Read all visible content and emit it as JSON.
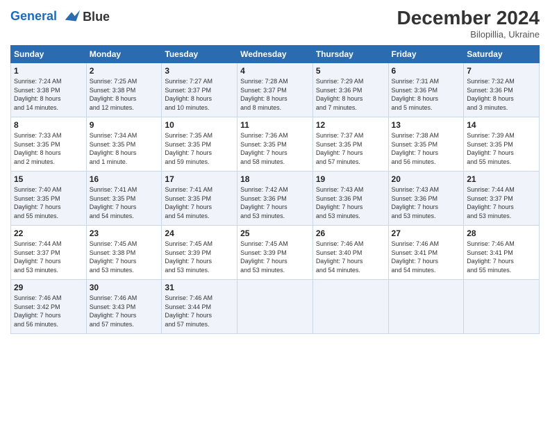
{
  "header": {
    "logo_line1": "General",
    "logo_line2": "Blue",
    "month": "December 2024",
    "location": "Bilopillia, Ukraine"
  },
  "weekdays": [
    "Sunday",
    "Monday",
    "Tuesday",
    "Wednesday",
    "Thursday",
    "Friday",
    "Saturday"
  ],
  "weeks": [
    [
      {
        "day": "1",
        "info": "Sunrise: 7:24 AM\nSunset: 3:38 PM\nDaylight: 8 hours\nand 14 minutes."
      },
      {
        "day": "2",
        "info": "Sunrise: 7:25 AM\nSunset: 3:38 PM\nDaylight: 8 hours\nand 12 minutes."
      },
      {
        "day": "3",
        "info": "Sunrise: 7:27 AM\nSunset: 3:37 PM\nDaylight: 8 hours\nand 10 minutes."
      },
      {
        "day": "4",
        "info": "Sunrise: 7:28 AM\nSunset: 3:37 PM\nDaylight: 8 hours\nand 8 minutes."
      },
      {
        "day": "5",
        "info": "Sunrise: 7:29 AM\nSunset: 3:36 PM\nDaylight: 8 hours\nand 7 minutes."
      },
      {
        "day": "6",
        "info": "Sunrise: 7:31 AM\nSunset: 3:36 PM\nDaylight: 8 hours\nand 5 minutes."
      },
      {
        "day": "7",
        "info": "Sunrise: 7:32 AM\nSunset: 3:36 PM\nDaylight: 8 hours\nand 3 minutes."
      }
    ],
    [
      {
        "day": "8",
        "info": "Sunrise: 7:33 AM\nSunset: 3:35 PM\nDaylight: 8 hours\nand 2 minutes."
      },
      {
        "day": "9",
        "info": "Sunrise: 7:34 AM\nSunset: 3:35 PM\nDaylight: 8 hours\nand 1 minute."
      },
      {
        "day": "10",
        "info": "Sunrise: 7:35 AM\nSunset: 3:35 PM\nDaylight: 7 hours\nand 59 minutes."
      },
      {
        "day": "11",
        "info": "Sunrise: 7:36 AM\nSunset: 3:35 PM\nDaylight: 7 hours\nand 58 minutes."
      },
      {
        "day": "12",
        "info": "Sunrise: 7:37 AM\nSunset: 3:35 PM\nDaylight: 7 hours\nand 57 minutes."
      },
      {
        "day": "13",
        "info": "Sunrise: 7:38 AM\nSunset: 3:35 PM\nDaylight: 7 hours\nand 56 minutes."
      },
      {
        "day": "14",
        "info": "Sunrise: 7:39 AM\nSunset: 3:35 PM\nDaylight: 7 hours\nand 55 minutes."
      }
    ],
    [
      {
        "day": "15",
        "info": "Sunrise: 7:40 AM\nSunset: 3:35 PM\nDaylight: 7 hours\nand 55 minutes."
      },
      {
        "day": "16",
        "info": "Sunrise: 7:41 AM\nSunset: 3:35 PM\nDaylight: 7 hours\nand 54 minutes."
      },
      {
        "day": "17",
        "info": "Sunrise: 7:41 AM\nSunset: 3:35 PM\nDaylight: 7 hours\nand 54 minutes."
      },
      {
        "day": "18",
        "info": "Sunrise: 7:42 AM\nSunset: 3:36 PM\nDaylight: 7 hours\nand 53 minutes."
      },
      {
        "day": "19",
        "info": "Sunrise: 7:43 AM\nSunset: 3:36 PM\nDaylight: 7 hours\nand 53 minutes."
      },
      {
        "day": "20",
        "info": "Sunrise: 7:43 AM\nSunset: 3:36 PM\nDaylight: 7 hours\nand 53 minutes."
      },
      {
        "day": "21",
        "info": "Sunrise: 7:44 AM\nSunset: 3:37 PM\nDaylight: 7 hours\nand 53 minutes."
      }
    ],
    [
      {
        "day": "22",
        "info": "Sunrise: 7:44 AM\nSunset: 3:37 PM\nDaylight: 7 hours\nand 53 minutes."
      },
      {
        "day": "23",
        "info": "Sunrise: 7:45 AM\nSunset: 3:38 PM\nDaylight: 7 hours\nand 53 minutes."
      },
      {
        "day": "24",
        "info": "Sunrise: 7:45 AM\nSunset: 3:39 PM\nDaylight: 7 hours\nand 53 minutes."
      },
      {
        "day": "25",
        "info": "Sunrise: 7:45 AM\nSunset: 3:39 PM\nDaylight: 7 hours\nand 53 minutes."
      },
      {
        "day": "26",
        "info": "Sunrise: 7:46 AM\nSunset: 3:40 PM\nDaylight: 7 hours\nand 54 minutes."
      },
      {
        "day": "27",
        "info": "Sunrise: 7:46 AM\nSunset: 3:41 PM\nDaylight: 7 hours\nand 54 minutes."
      },
      {
        "day": "28",
        "info": "Sunrise: 7:46 AM\nSunset: 3:41 PM\nDaylight: 7 hours\nand 55 minutes."
      }
    ],
    [
      {
        "day": "29",
        "info": "Sunrise: 7:46 AM\nSunset: 3:42 PM\nDaylight: 7 hours\nand 56 minutes."
      },
      {
        "day": "30",
        "info": "Sunrise: 7:46 AM\nSunset: 3:43 PM\nDaylight: 7 hours\nand 57 minutes."
      },
      {
        "day": "31",
        "info": "Sunrise: 7:46 AM\nSunset: 3:44 PM\nDaylight: 7 hours\nand 57 minutes."
      },
      {
        "day": "",
        "info": ""
      },
      {
        "day": "",
        "info": ""
      },
      {
        "day": "",
        "info": ""
      },
      {
        "day": "",
        "info": ""
      }
    ]
  ]
}
